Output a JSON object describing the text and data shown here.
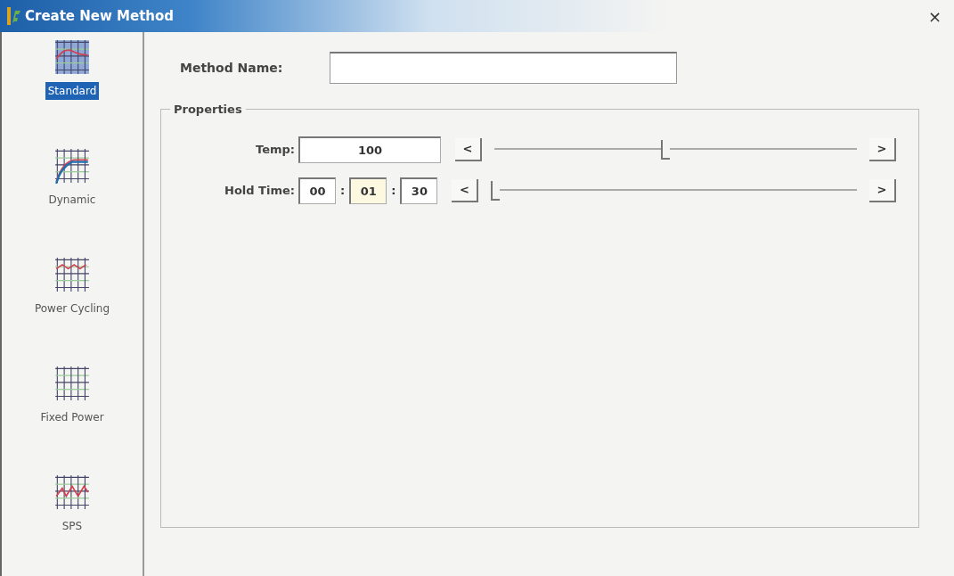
{
  "window": {
    "title": "Create New Method",
    "close": "×"
  },
  "sidebar": {
    "items": [
      {
        "label": "Standard",
        "selected": true
      },
      {
        "label": "Dynamic",
        "selected": false
      },
      {
        "label": "Power Cycling",
        "selected": false
      },
      {
        "label": "Fixed Power",
        "selected": false
      },
      {
        "label": "SPS",
        "selected": false
      }
    ]
  },
  "method_name": {
    "label": "Method Name:"
  },
  "properties": {
    "title": "Properties",
    "temp": {
      "label": "Temp:",
      "value": "100",
      "decrease": "<",
      "increase": ">",
      "level": 0.47
    },
    "hold_time": {
      "label": "Hold Time:",
      "segments": [
        {
          "value": "00",
          "focused": false
        },
        {
          "value": "01",
          "focused": true
        },
        {
          "value": "30",
          "focused": false
        }
      ],
      "separator": ":",
      "decrease": "<",
      "increase": ">",
      "level": 0.0
    }
  }
}
